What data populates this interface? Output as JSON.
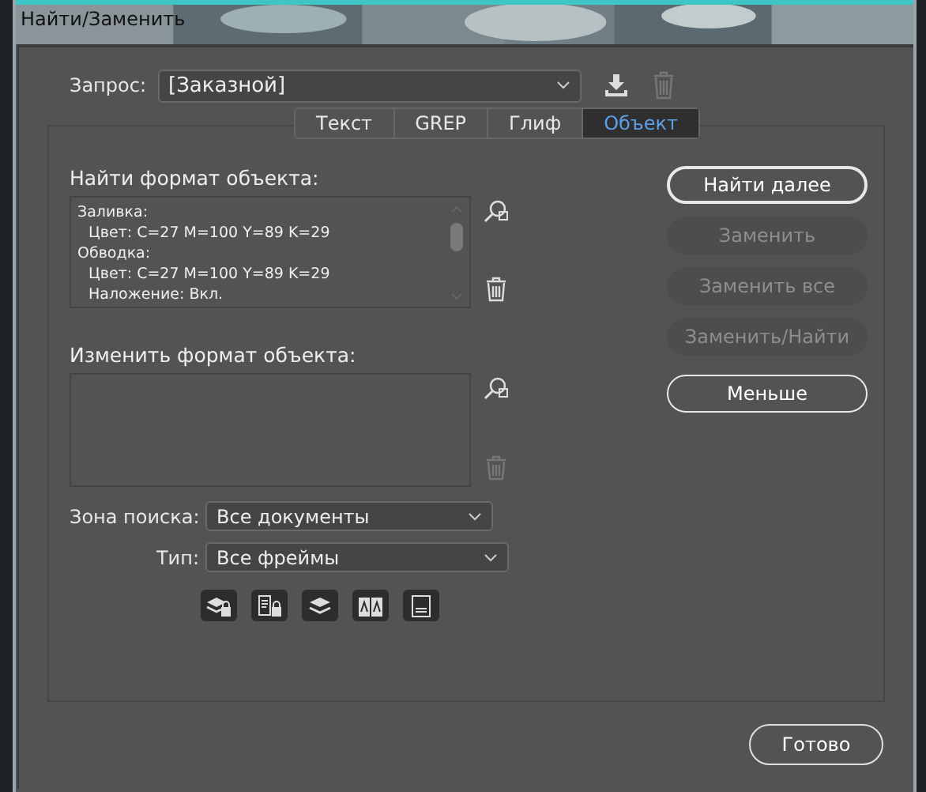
{
  "window": {
    "title": "Найти/Заменить"
  },
  "query": {
    "label": "Запрос:",
    "value": "[Заказной]"
  },
  "tabs": [
    {
      "label": "Текст",
      "selected": false
    },
    {
      "label": "GREP",
      "selected": false
    },
    {
      "label": "Глиф",
      "selected": false
    },
    {
      "label": "Объект",
      "selected": true
    }
  ],
  "find_format": {
    "label": "Найти формат объекта:",
    "items": [
      {
        "text": "Заливка:",
        "children": [
          {
            "text": "Цвет: C=27 M=100 Y=89 K=29"
          }
        ]
      },
      {
        "text": "Обводка:",
        "children": [
          {
            "text": "Цвет: C=27 M=100 Y=89 K=29"
          },
          {
            "text": "Наложение: Вкл."
          }
        ]
      }
    ]
  },
  "change_format": {
    "label": "Изменить формат объекта:"
  },
  "search_zone": {
    "label": "Зона поиска:",
    "value": "Все документы"
  },
  "type": {
    "label": "Тип:",
    "value": "Все фреймы"
  },
  "buttons": [
    {
      "label": "Найти далее",
      "disabled": false
    },
    {
      "label": "Заменить",
      "disabled": true
    },
    {
      "label": "Заменить все",
      "disabled": true
    },
    {
      "label": "Заменить/Найти",
      "disabled": true
    },
    {
      "label": "Меньше",
      "disabled": false
    }
  ],
  "done_button": {
    "label": "Готово"
  }
}
